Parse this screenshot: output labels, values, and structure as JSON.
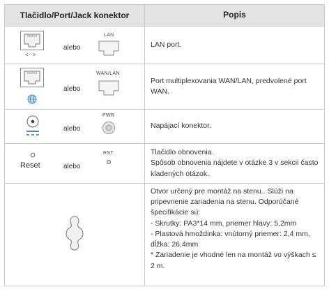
{
  "header": {
    "left": "Tlačidlo/Port/Jack konektor",
    "right": "Popis"
  },
  "rows": [
    {
      "or": "alebo",
      "label": "LAN",
      "arrows": "<··>",
      "desc": "LAN port."
    },
    {
      "or": "alebo",
      "label": "WAN/LAN",
      "desc": "Port multiplexovania WAN/LAN, predvolené port WAN."
    },
    {
      "or": "alebo",
      "label": "PWR",
      "desc": "Napájací konektor."
    },
    {
      "name": "Reset",
      "or": "alebo",
      "label": "RST",
      "desc_line1": "Tlačidlo obnovenia.",
      "desc_line2": "Spôsob obnovenia nájdete v otázke 3 v sekcii často kladených otázok."
    },
    {
      "desc_intro": "Otvor určený pre montáž na stenu.. Slúži na pripevnenie zariadenia na stenu. Odporúčané špecifikácie sú:",
      "bullet1": "- Skrutky: PA3*14 mm, priemer hlavy: 5,2mm",
      "bullet2": "- Plastová hmoždinka: vnútorný priemer: 2,4 mm, dĺžka: 26,4mm",
      "bullet3": "* Zariadenie je vhodné len na montáž vo výškach ≤ 2 m."
    }
  ],
  "colors": {
    "header_bg": "#e3e3e3",
    "border": "#c9c9c9",
    "globe": "#2a8fd6"
  }
}
